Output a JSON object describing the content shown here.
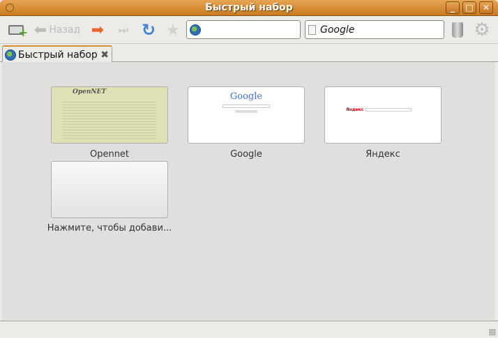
{
  "window": {
    "title": "Быстрый набор",
    "minimize": "_",
    "maximize": "□",
    "close": "✕"
  },
  "toolbar": {
    "back_label": "Назад",
    "search_value": "Google",
    "address_value": ""
  },
  "tab": {
    "label": "Быстрый набор",
    "close": "✖"
  },
  "speed_dial": [
    {
      "label": "Opennet",
      "logo": "OpenNET"
    },
    {
      "label": "Google",
      "logo": "Google"
    },
    {
      "label": "Яндекс",
      "logo": "Яндекс"
    },
    {
      "label": "Нажмите, чтобы добави...",
      "logo": ""
    }
  ]
}
